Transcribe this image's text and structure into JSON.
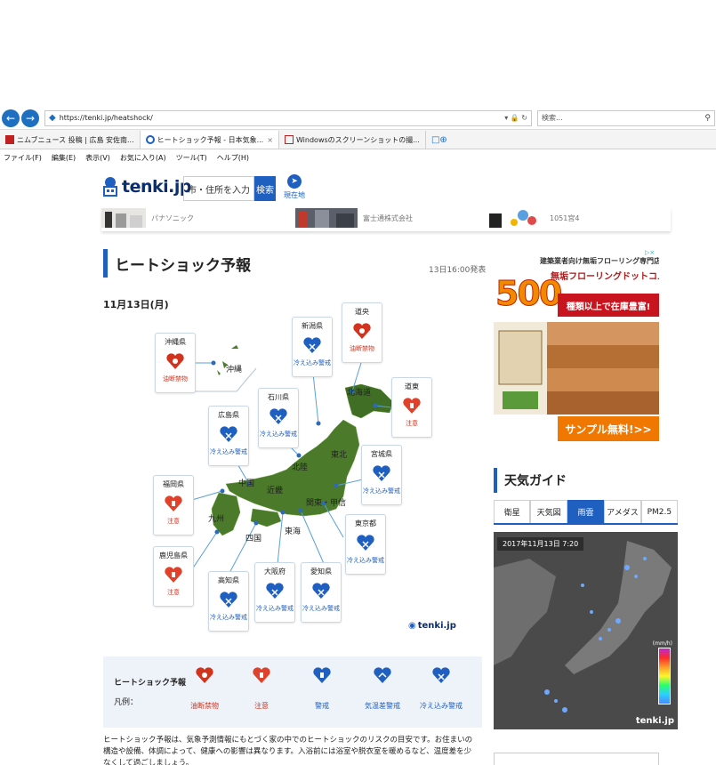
{
  "browser": {
    "url": "https://tenki.jp/heatshock/",
    "search_placeholder": "検索...",
    "tabs": [
      {
        "label": "ニムブニュース 投稿 | 広島 安佐南...",
        "active": false
      },
      {
        "label": "ヒートショック予報 - 日本気象...",
        "active": true
      },
      {
        "label": "Windowsのスクリーンショットの撮...",
        "active": false
      }
    ],
    "menu": [
      "ファイル(F)",
      "編集(E)",
      "表示(V)",
      "お気に入り(A)",
      "ツール(T)",
      "ヘルプ(H)"
    ]
  },
  "site": {
    "logo": "tenki.jp",
    "search_placeholder": "市・住所を入力",
    "search_button": "検索",
    "geo_button": "現在地"
  },
  "adstrip": {
    "items": [
      "パナソニック",
      "富士通株式会社",
      "1051宮4"
    ]
  },
  "page": {
    "title": "ヒートショック予報",
    "published": "13日16:00発表",
    "date": "11月13日(月)"
  },
  "map": {
    "prefectures": [
      {
        "name": "沖縄県",
        "status": "油断禁物",
        "level": "danger"
      },
      {
        "name": "新潟県",
        "status": "冷え込み警戒",
        "level": "cold"
      },
      {
        "name": "道央",
        "status": "油断禁物",
        "level": "danger"
      },
      {
        "name": "道東",
        "status": "注意",
        "level": "caution"
      },
      {
        "name": "石川県",
        "status": "冷え込み警戒",
        "level": "cold"
      },
      {
        "name": "広島県",
        "status": "冷え込み警戒",
        "level": "cold"
      },
      {
        "name": "宮城県",
        "status": "冷え込み警戒",
        "level": "cold"
      },
      {
        "name": "福岡県",
        "status": "注意",
        "level": "caution"
      },
      {
        "name": "東京都",
        "status": "冷え込み警戒",
        "level": "cold"
      },
      {
        "name": "鹿児島県",
        "status": "注意",
        "level": "caution"
      },
      {
        "name": "高知県",
        "status": "冷え込み警戒",
        "level": "cold"
      },
      {
        "name": "大阪府",
        "status": "冷え込み警戒",
        "level": "cold"
      },
      {
        "name": "愛知県",
        "status": "冷え込み警戒",
        "level": "cold"
      }
    ],
    "regions": [
      "沖縄",
      "北海道",
      "東北",
      "北陸",
      "中国",
      "近畿",
      "関東・甲信",
      "九州",
      "四国",
      "東海"
    ],
    "brand": "tenki.jp"
  },
  "legend": {
    "title": "ヒートショック予報",
    "subtitle": "凡例：",
    "items": [
      "油断禁物",
      "注意",
      "警戒",
      "気温差警戒",
      "冷え込み警戒"
    ],
    "note": "ヒートショック予報は、気象予測情報にもとづく家の中でのヒートショックのリスクの目安です。お住まいの構造や設備、体調によって、健康への影響は異なります。入浴前には浴室や脱衣室を暖めるなど、温度差を少なくして過ごしましょう。"
  },
  "right_ad": {
    "line1": "建築業者向け無垢フローリング専門店",
    "line2": "無垢フローリングドットコム",
    "big": "500",
    "redbar": "種類以上で在庫豊富!",
    "cta": "サンプル無料!>>"
  },
  "weather_guide": {
    "title": "天気ガイド",
    "tabs": [
      "衛星",
      "天気図",
      "雨雲",
      "アメダス",
      "PM2.5"
    ],
    "active_tab": 2,
    "stamp": "2017年11月13日 7:20",
    "unit": "(mm/h)",
    "brand": "tenki.jp"
  },
  "colors": {
    "accent": "#1f5fbf",
    "danger": "#d2331c",
    "cold": "#1f5fbf"
  }
}
